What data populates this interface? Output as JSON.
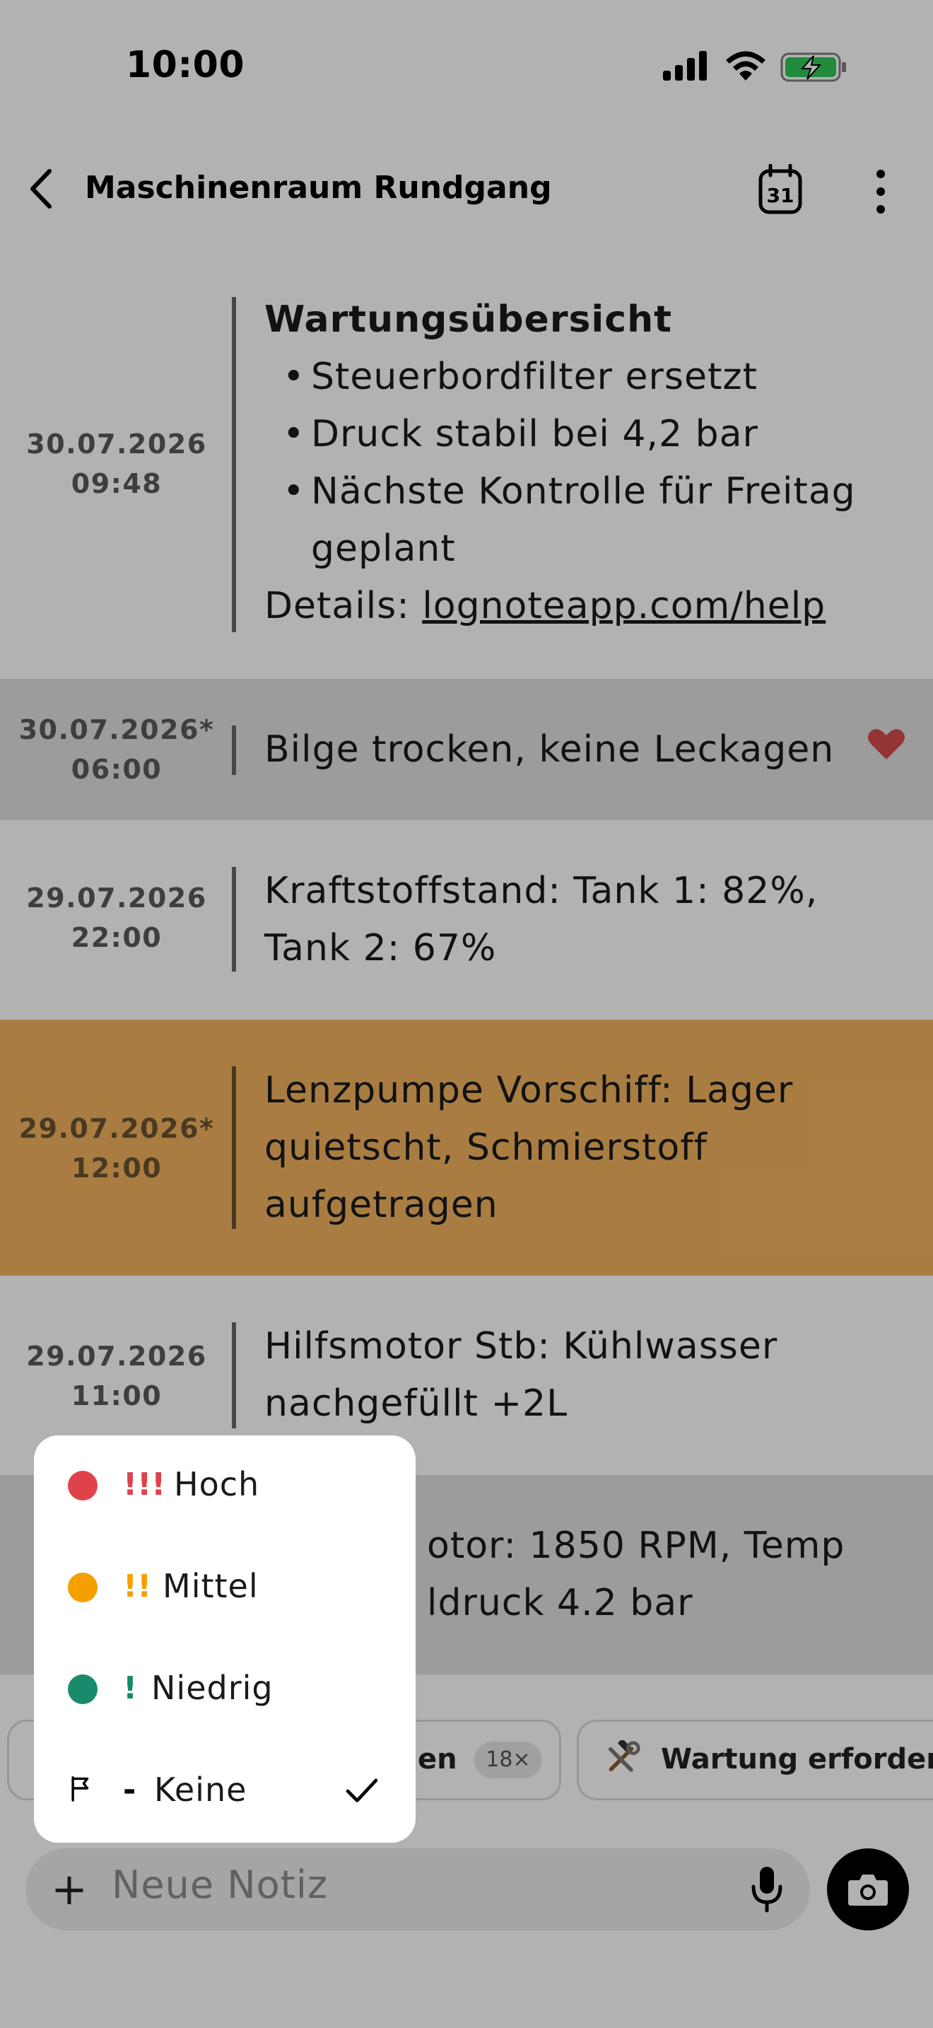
{
  "status_bar": {
    "time": "10:00"
  },
  "header": {
    "title": "Maschinenraum Rundgang",
    "calendar_day": "31"
  },
  "entries": [
    {
      "date": "30.07.2026",
      "time": "09:48",
      "heading": "Wartungsübersicht",
      "bullets": [
        "Steuerbordfilter ersetzt",
        "Druck stabil bei 4,2 bar",
        "Nächste Kontrolle für Freitag geplant"
      ],
      "details_label": "Details:",
      "details_link": "lognoteapp.com/help"
    },
    {
      "date": "30.07.2026*",
      "time": "06:00",
      "text": "Bilge trocken, keine Leckagen",
      "favorite": true
    },
    {
      "date": "29.07.2026",
      "time": "22:00",
      "text": "Kraftstoffstand: Tank 1: 82%, Tank 2: 67%"
    },
    {
      "date": "29.07.2026*",
      "time": "12:00",
      "text": "Lenzpumpe Vorschiff: Lager quietscht, Schmierstoff aufgetragen",
      "highlight": "#f3b45f"
    },
    {
      "date": "29.07.2026",
      "time": "11:00",
      "text": "Hilfsmotor Stb: Kühlwasser nachgefüllt +2L"
    },
    {
      "text_line1": "otor: 1850 RPM, Temp",
      "text_line2": "ldruck 4.2 bar"
    }
  ],
  "chips": [
    {
      "label": "en",
      "count": "18×"
    },
    {
      "label": "Wartung erforderli",
      "icon": "hammer-wrench-icon"
    }
  ],
  "composer": {
    "placeholder": "Neue Notiz"
  },
  "priority_menu": {
    "items": [
      {
        "marks": "!!!",
        "label": "Hoch",
        "color": "#e0424c"
      },
      {
        "marks": "!!",
        "label": "Mittel",
        "color": "#f5a000"
      },
      {
        "marks": "!",
        "label": "Niedrig",
        "color": "#1a8a6c"
      },
      {
        "marks": "-",
        "label": "Keine",
        "selected": true
      }
    ]
  },
  "colors": {
    "scrim": "rgba(0,0,0,0.30)",
    "favorite_row": "#e0e0e0",
    "highlight_row": "#f3b45f",
    "heart": "#d44b4b"
  }
}
